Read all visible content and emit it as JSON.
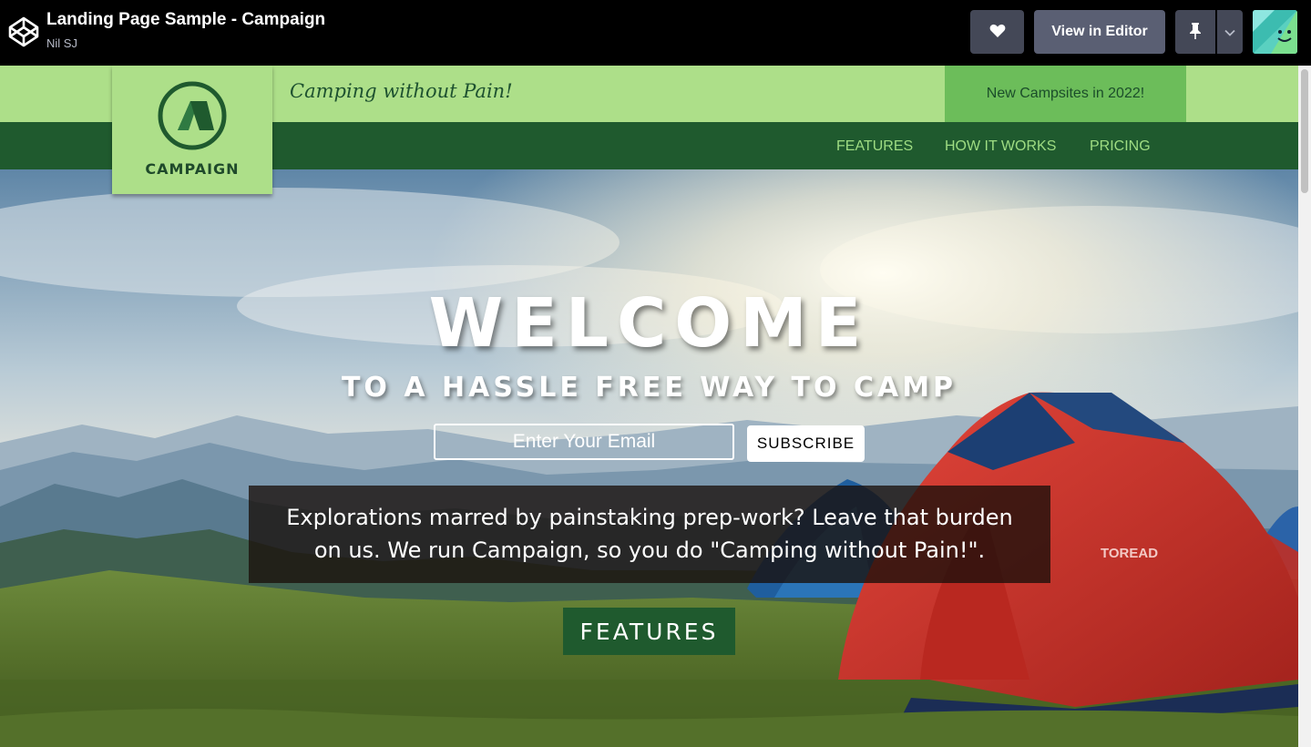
{
  "codepen": {
    "title": "Landing Page Sample - Campaign",
    "author": "Nil SJ",
    "view_in_editor_label": "View in Editor",
    "icons": {
      "logo": "codepen-logo-icon",
      "heart": "heart-icon",
      "pin": "pin-icon",
      "caret": "chevron-down-icon",
      "avatar": "user-avatar"
    }
  },
  "site": {
    "tagline": "Camping without Pain!",
    "announcement": "New Campsites in 2022!",
    "logo_text": "CAMPAIGN",
    "nav": [
      {
        "label": "FEATURES"
      },
      {
        "label": "HOW IT WORKS"
      },
      {
        "label": "PRICING"
      }
    ],
    "colors": {
      "light_green": "#addf89",
      "dark_green": "#1f5a2e",
      "announcement_green": "#6cbd5a"
    }
  },
  "hero": {
    "welcome": "WELCOME",
    "subhead": "TO A HASSLE FREE WAY TO CAMP",
    "email_placeholder": "Enter Your Email",
    "subscribe_label": "SUBSCRIBE",
    "blurb_line1": "Explorations marred by painstaking prep-work? Leave that burden",
    "blurb_line2": "on us. We run Campaign, so you do \"Camping without Pain!\".",
    "features_label": "FEATURES",
    "tent_brand": "TOREAD"
  }
}
